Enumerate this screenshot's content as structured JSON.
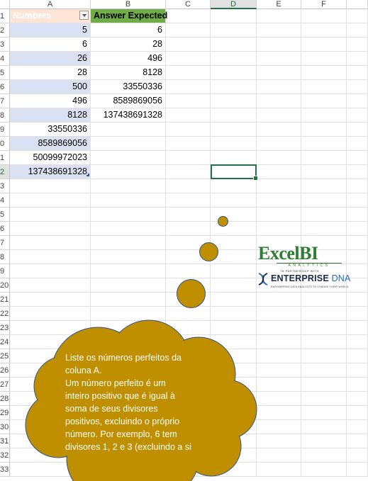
{
  "columns": [
    "A",
    "B",
    "C",
    "D",
    "E",
    "F"
  ],
  "active_column": "D",
  "active_row": "2",
  "rows": [
    "1",
    "2",
    "3",
    "4",
    "5",
    "6",
    "7",
    "8",
    "9",
    "0",
    "1",
    "2",
    "3",
    "4",
    "5",
    "6",
    "7",
    "8",
    "9",
    "20",
    "21",
    "22",
    "23",
    "24",
    "25",
    "26",
    "27",
    "28",
    "29",
    "30",
    "31",
    "32",
    "33"
  ],
  "table": {
    "header_a": "Numbers",
    "header_b": "Answer Expected",
    "col_a": [
      "5",
      "6",
      "26",
      "28",
      "500",
      "496",
      "8128",
      "33550336",
      "8589869056",
      "50099972023",
      "137438691328"
    ],
    "col_b": [
      "6",
      "28",
      "496",
      "8128",
      "33550336",
      "8589869056",
      "137438691328"
    ]
  },
  "callout": {
    "lines": [
      "Liste os números perfeitos da",
      "coluna A.",
      "Um número perfeito é um",
      "inteiro positivo que é igual à",
      "soma de seus divisores",
      "positivos, excluindo o próprio",
      "número. Por exemplo, 6 tem",
      "divisores 1, 2 e 3 (excluindo a si"
    ]
  },
  "logo": {
    "excel_text": "Excel",
    "bi_text": "BI",
    "analytics_text": "ANALYTICS",
    "partner_text": "IN PARTNERSHIP WITH",
    "enterprise_text": "ENTERPRISE",
    "dna_text": "DNA",
    "tagline": "EMPOWERING DATA ANALYSTS TO CHANGE THEIR WORLD"
  },
  "colors": {
    "header_a_fill": "#fce4d6",
    "header_b_fill": "#70ad47",
    "band_fill": "#d9e1f2",
    "callout_fill": "#bf8f00",
    "selection": "#217346"
  }
}
